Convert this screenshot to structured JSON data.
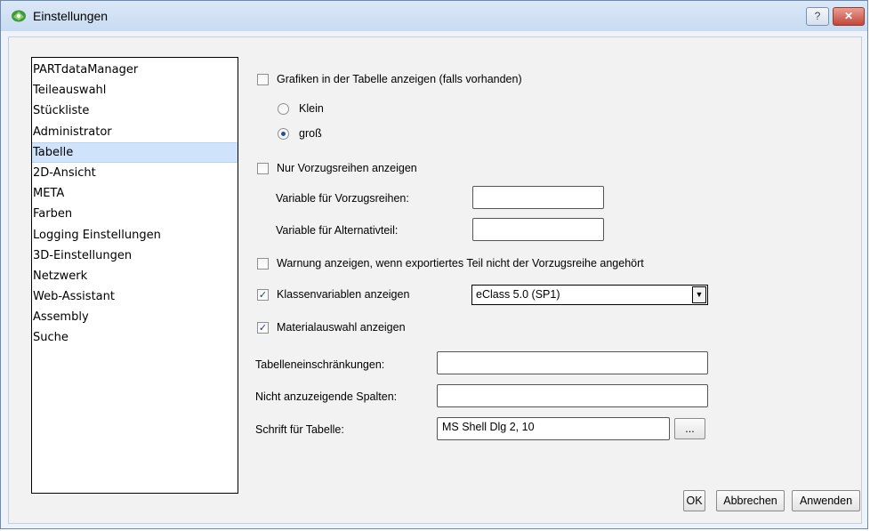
{
  "window": {
    "title": "Einstellungen",
    "help_label": "?",
    "close_label": "✕"
  },
  "sidebar": {
    "items": [
      {
        "label": "PARTdataManager"
      },
      {
        "label": "Teileauswahl"
      },
      {
        "label": "Stückliste"
      },
      {
        "label": "Administrator"
      },
      {
        "label": "Tabelle"
      },
      {
        "label": "2D-Ansicht"
      },
      {
        "label": "META"
      },
      {
        "label": "Farben"
      },
      {
        "label": "Logging Einstellungen"
      },
      {
        "label": "3D-Einstellungen"
      },
      {
        "label": "Netzwerk"
      },
      {
        "label": "Web-Assistant"
      },
      {
        "label": "Assembly"
      },
      {
        "label": "Suche"
      }
    ],
    "selected": "Tabelle"
  },
  "settings": {
    "show_graphics": {
      "label": "Grafiken in der Tabelle anzeigen (falls vorhanden)",
      "checked": false
    },
    "size_small": {
      "label": "Klein",
      "selected": false
    },
    "size_large": {
      "label": "groß",
      "selected": true
    },
    "preferred_only": {
      "label": "Nur Vorzugsreihen anzeigen",
      "checked": false
    },
    "var_preferred": {
      "label": "Variable für Vorzugsreihen:",
      "value": ""
    },
    "var_alternative": {
      "label": "Variable für Alternativteil:",
      "value": ""
    },
    "warning": {
      "label": "Warnung anzeigen, wenn exportiertes Teil nicht der Vorzugsreihe angehört",
      "checked": false
    },
    "class_vars": {
      "label": "Klassenvariablen anzeigen",
      "checked": true,
      "value": "eClass 5.0 (SP1)"
    },
    "material": {
      "label": "Materialauswahl anzeigen",
      "checked": true
    },
    "table_restrictions": {
      "label": "Tabelleneinschränkungen:",
      "value": ""
    },
    "hidden_columns": {
      "label": "Nicht anzuzeigende Spalten:",
      "value": ""
    },
    "table_font": {
      "label": "Schrift für Tabelle:",
      "value": "MS Shell Dlg 2, 10",
      "browse_label": "..."
    }
  },
  "buttons": {
    "ok": "OK",
    "cancel": "Abbrechen",
    "apply": "Anwenden"
  },
  "check_glyph": "✓",
  "arrow_glyph": "▼"
}
